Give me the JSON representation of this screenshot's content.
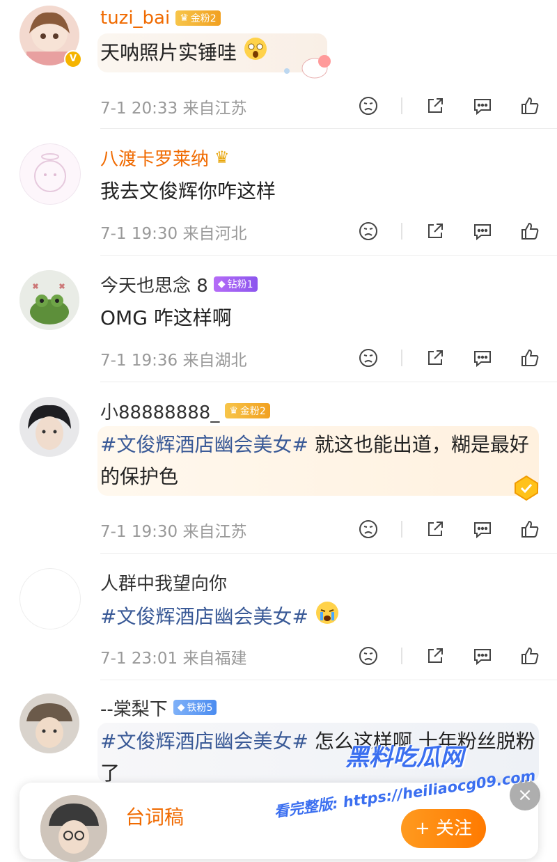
{
  "comments": [
    {
      "username": "tuzi_bai",
      "badge": "金粉2",
      "text": "天呐照片实锤哇",
      "time": "7-1 20:33",
      "location": "来自江苏",
      "verified": "V"
    },
    {
      "username": "八渡卡罗莱纳",
      "text": "我去文俊辉你咋这样",
      "time": "7-1 19:30",
      "location": "来自河北"
    },
    {
      "username": "今天也思念 8",
      "badge": "钻粉1",
      "text": "OMG 咋这样啊",
      "time": "7-1 19:36",
      "location": "来自湖北"
    },
    {
      "username": "小88888888_",
      "badge": "金粉2",
      "tag": "#文俊辉酒店幽会美女#",
      "text": " 就这也能出道，糊是最好的保护色",
      "time": "7-1 19:30",
      "location": "来自江苏"
    },
    {
      "username": "人群中我望向你",
      "tag": "#文俊辉酒店幽会美女#",
      "time": "7-1 23:01",
      "location": "来自福建"
    },
    {
      "username": "--棠梨下",
      "badge": "铁粉5",
      "tag": "#文俊辉酒店幽会美女#",
      "text": " 怎么这样啊 十年粉丝脱粉了"
    }
  ],
  "popup": {
    "name": "台词稿",
    "follow_label": "+ 关注",
    "close_label": "×"
  },
  "watermark": {
    "title": "黑料吃瓜网",
    "url": "看完整版: https://heiliaocg09.com"
  },
  "colors": {
    "name_orange": "#f06a00",
    "topic_blue": "#3a5a97",
    "meta_gray": "#999999",
    "follow_orange": "#ff8a00"
  }
}
